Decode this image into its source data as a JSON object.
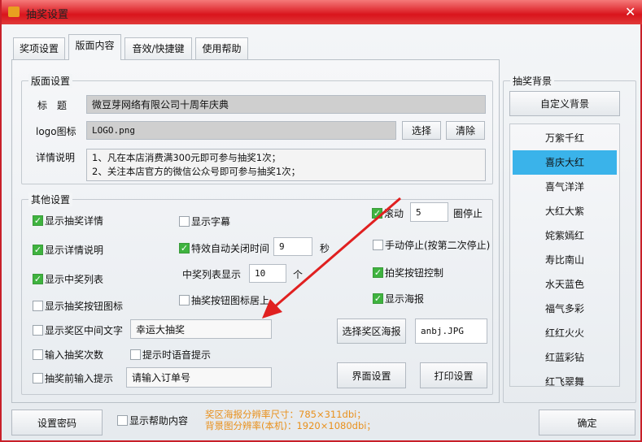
{
  "window": {
    "title": "抽奖设置",
    "close": "✕"
  },
  "tabs": [
    "奖项设置",
    "版面内容",
    "音效/快捷键",
    "使用帮助"
  ],
  "layout_group": {
    "label": "版面设置",
    "title_label": "标　题",
    "title_value": "微豆芽网络有限公司十周年庆典",
    "logo_label": "logo图标",
    "logo_value": "LOGO.png",
    "select_btn": "选择",
    "clear_btn": "清除",
    "detail_label": "详情说明",
    "detail_lines": [
      "1、凡在本店消费满300元即可参与抽奖1次；",
      "2、关注本店官方的微信公众号即可参与抽奖1次；"
    ]
  },
  "other": {
    "label": "其他设置",
    "show_draw_detail": "显示抽奖详情",
    "show_detail_desc": "显示详情说明",
    "show_winner_list": "显示中奖列表",
    "show_draw_btn_icon": "显示抽奖按钮图标",
    "show_center_text": "显示奖区中间文字",
    "center_text_value": "幸运大抽奖",
    "input_draw_count": "输入抽奖次数",
    "voice_prompt": "提示时语音提示",
    "pre_input_prompt": "抽奖前输入提示",
    "pre_input_value": "请输入订单号",
    "show_subtitle": "显示字幕",
    "effect_close": "特效自动关闭时间",
    "effect_close_value": "9",
    "seconds": "秒",
    "winner_list_show": "中奖列表显示",
    "winner_list_value": "10",
    "unit": "个",
    "btn_icon_top": "抽奖按钮图标居上",
    "scroll": "滚动",
    "scroll_value": "5",
    "circles_stop": "圈停止",
    "manual_stop": "手动停止(按第二次停止)",
    "draw_btn_control": "拍奖按钮控制",
    "show_poster": "显示海报",
    "select_poster_btn": "选择奖区海报",
    "poster_file": "anbj.JPG",
    "ui_settings_btn": "界面设置",
    "print_settings_btn": "打印设置"
  },
  "background": {
    "label": "抽奖背景",
    "custom_btn": "自定义背景",
    "items": [
      "万紫千红",
      "喜庆大红",
      "喜气洋洋",
      "大红大紫",
      "姹紫嫣红",
      "寿比南山",
      "水天蓝色",
      "福气多彩",
      "红红火火",
      "红蓝彩钻",
      "红飞翠舞"
    ],
    "selected": 1
  },
  "footer": {
    "set_password": "设置密码",
    "show_help": "显示帮助内容",
    "hint1": "奖区海报分辨率尺寸：785×311dbi；",
    "hint2": "背景图分辨率(本机)：1920×1080dbi；",
    "ok": "确定"
  },
  "colors": {
    "title_red": "#d9141c",
    "selected": "#3ab3ea",
    "check": "#3fb33f",
    "hint": "#e8901c",
    "arrow": "#e02020"
  }
}
